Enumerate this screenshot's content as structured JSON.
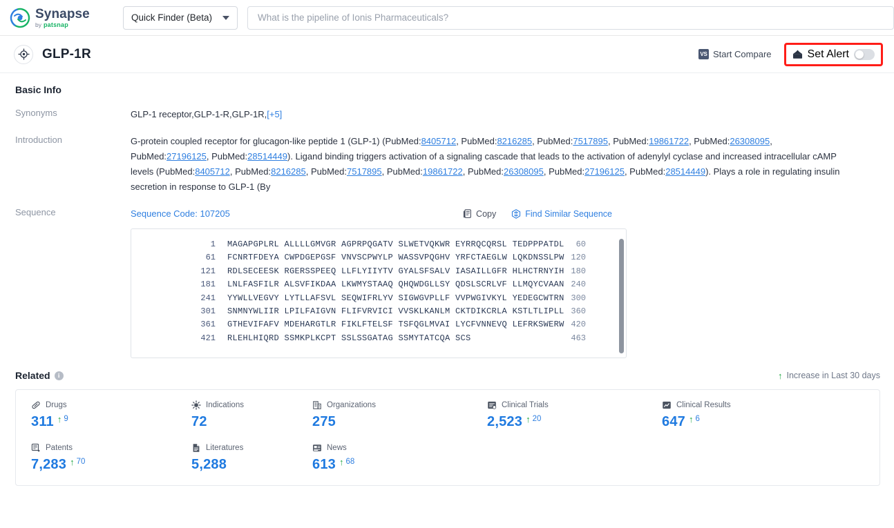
{
  "brand": {
    "name": "Synapse",
    "by": "by",
    "company": "patsnap"
  },
  "topbar": {
    "finder_label": "Quick Finder (Beta)",
    "search_placeholder": "What is the pipeline of Ionis Pharmaceuticals?",
    "search_value": ""
  },
  "title": {
    "name": "GLP-1R",
    "start_compare": "Start Compare",
    "vs_badge": "VS",
    "set_alert": "Set Alert",
    "alert_on": false,
    "highlight_color": "#ff1d18"
  },
  "basic_info": {
    "heading": "Basic Info",
    "synonyms_label": "Synonyms",
    "synonyms_value": "GLP-1 receptor,GLP-1-R,GLP-1R,",
    "synonyms_more": "[+5]",
    "introduction_label": "Introduction",
    "introduction_parts": [
      {
        "t": "G-protein coupled receptor for glucagon-like peptide 1 (GLP-1) (PubMed:"
      },
      {
        "t": "8405712",
        "link": true
      },
      {
        "t": ", PubMed:"
      },
      {
        "t": "8216285",
        "link": true
      },
      {
        "t": ", PubMed:"
      },
      {
        "t": "7517895",
        "link": true
      },
      {
        "t": ", PubMed:"
      },
      {
        "t": "19861722",
        "link": true
      },
      {
        "t": ", PubMed:"
      },
      {
        "t": "26308095",
        "link": true
      },
      {
        "t": ", PubMed:"
      },
      {
        "t": "27196125",
        "link": true
      },
      {
        "t": ", PubMed:"
      },
      {
        "t": "28514449",
        "link": true
      },
      {
        "t": "). Ligand binding triggers activation of a signaling cascade that leads to the activation of adenylyl cyclase and increased intracellular cAMP levels (PubMed:"
      },
      {
        "t": "8405712",
        "link": true
      },
      {
        "t": ", PubMed:"
      },
      {
        "t": "8216285",
        "link": true
      },
      {
        "t": ", PubMed:"
      },
      {
        "t": "7517895",
        "link": true
      },
      {
        "t": ", PubMed:"
      },
      {
        "t": "19861722",
        "link": true
      },
      {
        "t": ", PubMed:"
      },
      {
        "t": "26308095",
        "link": true
      },
      {
        "t": ", PubMed:"
      },
      {
        "t": "27196125",
        "link": true
      },
      {
        "t": ", PubMed:"
      },
      {
        "t": "28514449",
        "link": true
      },
      {
        "t": "). Plays a role in regulating insulin secretion in response to GLP-1 (By"
      }
    ]
  },
  "sequence": {
    "label": "Sequence",
    "code_label": "Sequence Code: 107205",
    "copy_label": "Copy",
    "find_similar_label": "Find Similar Sequence",
    "lines": [
      {
        "start": "1",
        "residues": "MAGAPGPLRL ALLLLGMVGR AGPRPQGATV SLWETVQKWR EYRRQCQRSL TEDPPPATDL",
        "end": "60"
      },
      {
        "start": "61",
        "residues": "FCNRTFDEYA CWPDGEPGSF VNVSCPWYLP WASSVPQGHV YRFCTAEGLW LQKDNSSLPW",
        "end": "120"
      },
      {
        "start": "121",
        "residues": "RDLSECEESK RGERSSPEEQ LLFLYIIYTV GYALSFSALV IASAILLGFR HLHCTRNYIH",
        "end": "180"
      },
      {
        "start": "181",
        "residues": "LNLFASFILR ALSVFIKDAA LKWMYSTAAQ QHQWDGLLSY QDSLSCRLVF LLMQYCVAAN",
        "end": "240"
      },
      {
        "start": "241",
        "residues": "YYWLLVEGVY LYTLLAFSVL SEQWIFRLYV SIGWGVPLLF VVPWGIVKYL YEDEGCWTRN",
        "end": "300"
      },
      {
        "start": "301",
        "residues": "SNMNYWLIIR LPILFAIGVN FLIFVRVICI VVSKLKANLM CKTDIKCRLA KSTLTLIPLL",
        "end": "360"
      },
      {
        "start": "361",
        "residues": "GTHEVIFAFV MDEHARGTLR FIKLFTELSF TSFQGLMVAI LYCFVNNEVQ LEFRKSWERW",
        "end": "420"
      },
      {
        "start": "421",
        "residues": "RLEHLHIQRD SSMKPLKCPT SSLSSGATAG SSMYTATCQA SCS",
        "end": "463"
      }
    ]
  },
  "related": {
    "heading": "Related",
    "increase_note": "Increase in Last 30 days",
    "arrow": "↑",
    "cards": [
      {
        "icon": "pill-icon",
        "label": "Drugs",
        "value": "311",
        "delta": "9"
      },
      {
        "icon": "virus-icon",
        "label": "Indications",
        "value": "72",
        "delta": ""
      },
      {
        "icon": "building-icon",
        "label": "Organizations",
        "value": "275",
        "delta": ""
      },
      {
        "icon": "clinical-trial-icon",
        "label": "Clinical Trials",
        "value": "2,523",
        "delta": "20"
      },
      {
        "icon": "clinical-result-icon",
        "label": "Clinical Results",
        "value": "647",
        "delta": "6"
      },
      {
        "icon": "patent-icon",
        "label": "Patents",
        "value": "7,283",
        "delta": "70"
      },
      {
        "icon": "literature-icon",
        "label": "Literatures",
        "value": "5,288",
        "delta": ""
      },
      {
        "icon": "news-icon",
        "label": "News",
        "value": "613",
        "delta": "68"
      }
    ]
  }
}
